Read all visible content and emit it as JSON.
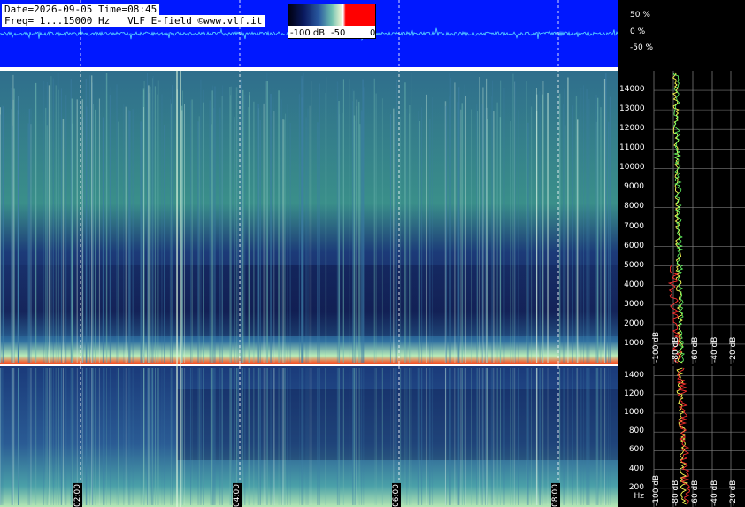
{
  "header": {
    "line1": "Date=2026-09-05 Time=08:45",
    "line2": "Freq= 1...15000 Hz   VLF E-field ©www.vlf.it"
  },
  "colorbar": {
    "ticks": [
      "-100 dB",
      "-50",
      "0"
    ]
  },
  "waveform_scale": [
    "50 %",
    "0 %",
    "-50 %"
  ],
  "colors": {
    "wave_bg": "#0018ff",
    "trace": "#5ad8ff",
    "separator": "#ffffff"
  },
  "chart_data": {
    "type": "heatmap",
    "title": "",
    "upper_panel": {
      "ylim_hz": [
        0,
        15000
      ],
      "y_ticks": [
        "14000",
        "13000",
        "12000",
        "11000",
        "10000",
        "9000",
        "8000",
        "7000",
        "6000",
        "5000",
        "4000",
        "3000",
        "2000",
        "1000"
      ]
    },
    "lower_panel": {
      "ylim_hz": [
        0,
        1500
      ],
      "y_ticks": [
        "1400",
        "1200",
        "1000",
        "800",
        "600",
        "400",
        "200 Hz"
      ]
    },
    "time_ticks": [
      "02:00",
      "04:00",
      "06:00",
      "08:00"
    ],
    "spectrum_db_ticks": [
      "-100 dB",
      "-80 dB",
      "-60 dB",
      "-40 dB",
      "-20 dB"
    ],
    "grid": true
  }
}
